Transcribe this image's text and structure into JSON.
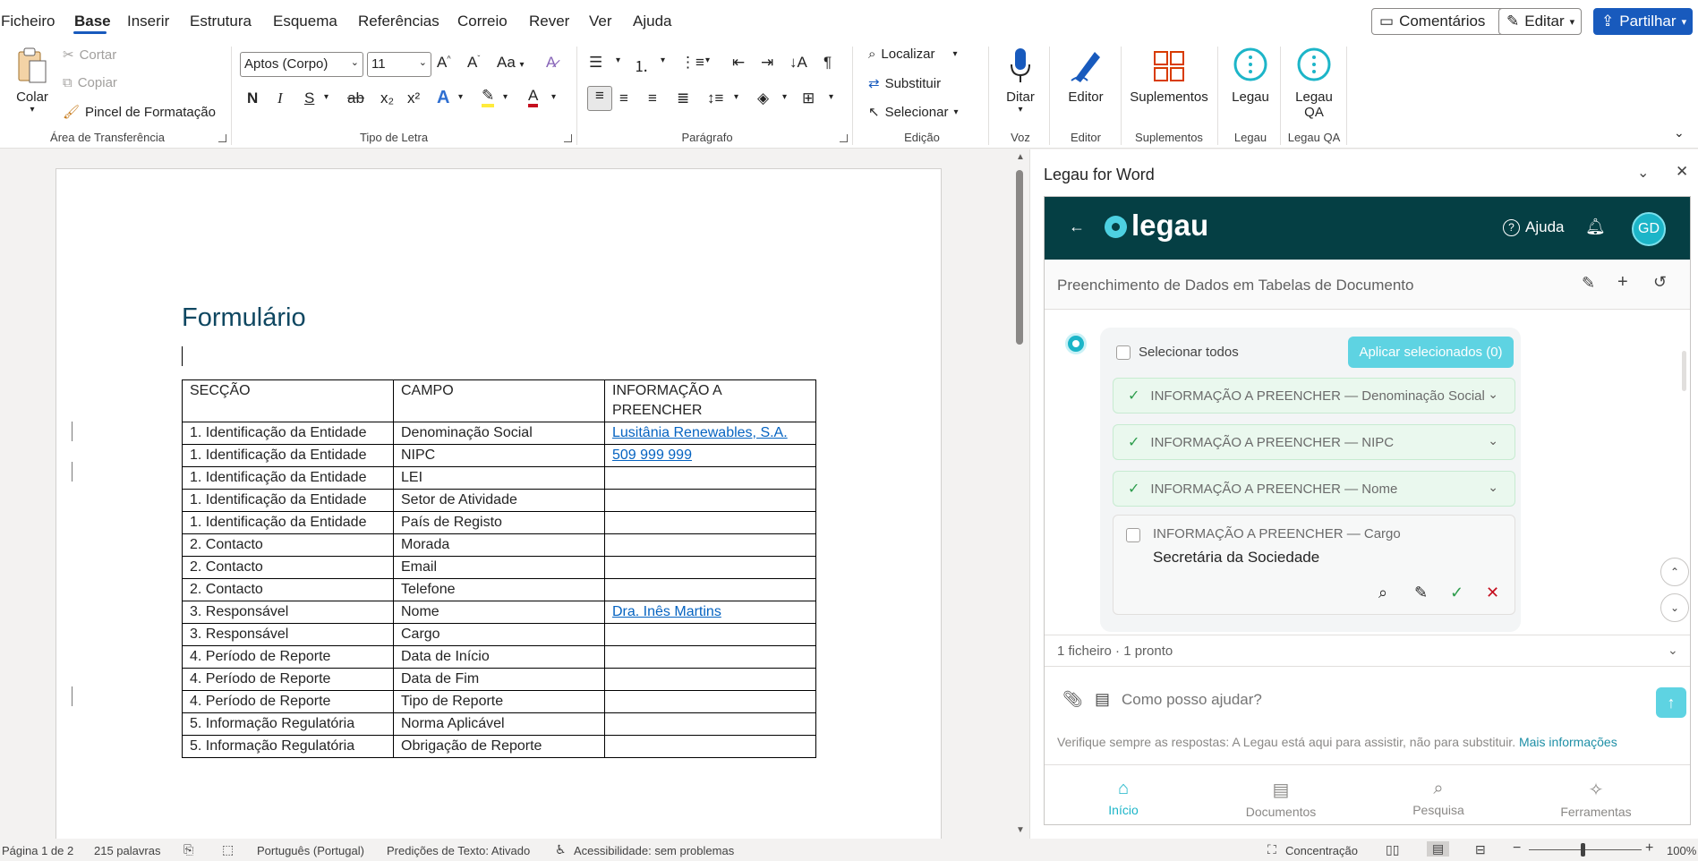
{
  "menu": {
    "items": [
      "Ficheiro",
      "Base",
      "Inserir",
      "Estrutura",
      "Esquema",
      "Referências",
      "Correio",
      "Rever",
      "Ver",
      "Ajuda"
    ],
    "active": "Base",
    "comments_label": "Comentários",
    "edit_label": "Editar",
    "share_label": "Partilhar"
  },
  "ribbon": {
    "clipboard": {
      "paste": "Colar",
      "cut": "Cortar",
      "copy": "Copiar",
      "format_painter": "Pincel de Formatação",
      "label": "Área de Transferência"
    },
    "font": {
      "family": "Aptos (Corpo)",
      "size": "11",
      "label": "Tipo de Letra",
      "bold": "N",
      "italic": "I",
      "underline": "S",
      "strike": "ab",
      "sub": "x₂",
      "sup": "x²",
      "case": "Aa"
    },
    "paragraph": {
      "label": "Parágrafo"
    },
    "editing": {
      "find": "Localizar",
      "replace": "Substituir",
      "select": "Selecionar",
      "label": "Edição"
    },
    "voice": {
      "dictate": "Ditar",
      "label": "Voz"
    },
    "editor": {
      "button": "Editor",
      "label": "Editor"
    },
    "addins": {
      "button": "Suplementos",
      "label": "Suplementos"
    },
    "legau": {
      "button": "Legau",
      "label": "Legau"
    },
    "legau_qa": {
      "button_line1": "Legau",
      "button_line2": "QA",
      "label": "Legau QA"
    }
  },
  "document": {
    "title": "Formulário",
    "table": {
      "headers": [
        "SECÇÃO",
        "CAMPO",
        "INFORMAÇÃO A PREENCHER"
      ],
      "rows": [
        [
          "1. Identificação da Entidade",
          "Denominação Social",
          "Lusitânia Renewables, S.A."
        ],
        [
          "1. Identificação da Entidade",
          "NIPC",
          "509 999 999"
        ],
        [
          "1. Identificação da Entidade",
          "LEI",
          ""
        ],
        [
          "1. Identificação da Entidade",
          "Setor de Atividade",
          ""
        ],
        [
          "1. Identificação da Entidade",
          "País de Registo",
          ""
        ],
        [
          "2. Contacto",
          "Morada",
          ""
        ],
        [
          "2. Contacto",
          "Email",
          ""
        ],
        [
          "2. Contacto",
          "Telefone",
          ""
        ],
        [
          "3. Responsável",
          "Nome",
          "Dra. Inês Martins"
        ],
        [
          "3. Responsável",
          "Cargo",
          ""
        ],
        [
          "4. Período de Reporte",
          "Data de Início",
          ""
        ],
        [
          "4. Período de Reporte",
          "Data de Fim",
          ""
        ],
        [
          "4. Período de Reporte",
          "Tipo de Reporte",
          ""
        ],
        [
          "5. Informação Regulatória",
          "Norma Aplicável",
          ""
        ],
        [
          "5. Informação Regulatória",
          "Obrigação de Reporte",
          ""
        ]
      ]
    }
  },
  "pane": {
    "title": "Legau for Word",
    "logo": "legau",
    "help": "Ajuda",
    "avatar": "GD",
    "session_title": "Preenchimento de Dados em Tabelas de Documento",
    "select_all": "Selecionar todos",
    "apply_selected": "Aplicar selecionados (0)",
    "items": [
      {
        "label": "INFORMAÇÃO A PREENCHER — Denominação Social",
        "status": "applied"
      },
      {
        "label": "INFORMAÇÃO A PREENCHER — NIPC",
        "status": "applied"
      },
      {
        "label": "INFORMAÇÃO A PREENCHER — Nome",
        "status": "applied"
      }
    ],
    "pending_item": {
      "label": "INFORMAÇÃO A PREENCHER — Cargo",
      "value": "Secretária da Sociedade"
    },
    "files_summary": "1 ficheiro · 1 pronto",
    "chat_placeholder": "Como posso ajudar?",
    "disclaimer": "Verifique sempre as respostas: A Legau está aqui para assistir, não para substituir.",
    "more_info": "Mais informações",
    "nav": [
      "Início",
      "Documentos",
      "Pesquisa",
      "Ferramentas"
    ],
    "nav_active": "Início"
  },
  "status": {
    "page": "Página 1 de 2",
    "words": "215 palavras",
    "language": "Português (Portugal)",
    "predictions": "Predições de Texto: Ativado",
    "accessibility": "Acessibilidade: sem problemas",
    "focus": "Concentração",
    "zoom": "100%"
  },
  "colors": {
    "word_blue": "#185abd",
    "legau_dark": "#053f44",
    "legau_accent": "#1cb5c8",
    "heading": "#0f4761"
  }
}
